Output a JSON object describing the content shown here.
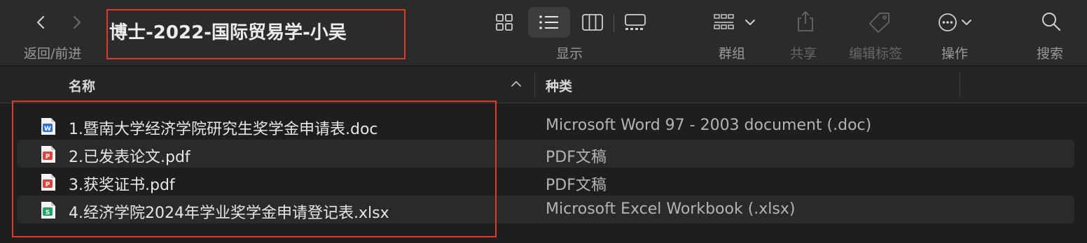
{
  "toolbar": {
    "nav_label": "返回/前进",
    "title": "博士-2022-国际贸易学-小吴",
    "view_label": "显示",
    "group_label": "群组",
    "share_label": "共享",
    "edit_tags_label": "编辑标签",
    "action_label": "操作",
    "search_label": "搜索"
  },
  "columns": {
    "name": "名称",
    "kind": "种类"
  },
  "files": [
    {
      "name": "1.暨南大学经济学院研究生奖学金申请表.doc",
      "kind": "Microsoft Word 97 - 2003 document (.doc)",
      "icon": "word-doc-icon",
      "color": "#2b6fe0"
    },
    {
      "name": "2.已发表论文.pdf",
      "kind": "PDF文稿",
      "icon": "pdf-icon",
      "color": "#e0413b"
    },
    {
      "name": "3.获奖证书.pdf",
      "kind": "PDF文稿",
      "icon": "pdf-icon",
      "color": "#e0413b"
    },
    {
      "name": "4.经济学院2024年学业奖学金申请登记表.xlsx",
      "kind": "Microsoft Excel Workbook (.xlsx)",
      "icon": "excel-icon",
      "color": "#1fa463"
    }
  ],
  "colors": {
    "highlight": "#e03a26",
    "background": "#1e1e1e",
    "toolbar": "#2b2b2b"
  }
}
